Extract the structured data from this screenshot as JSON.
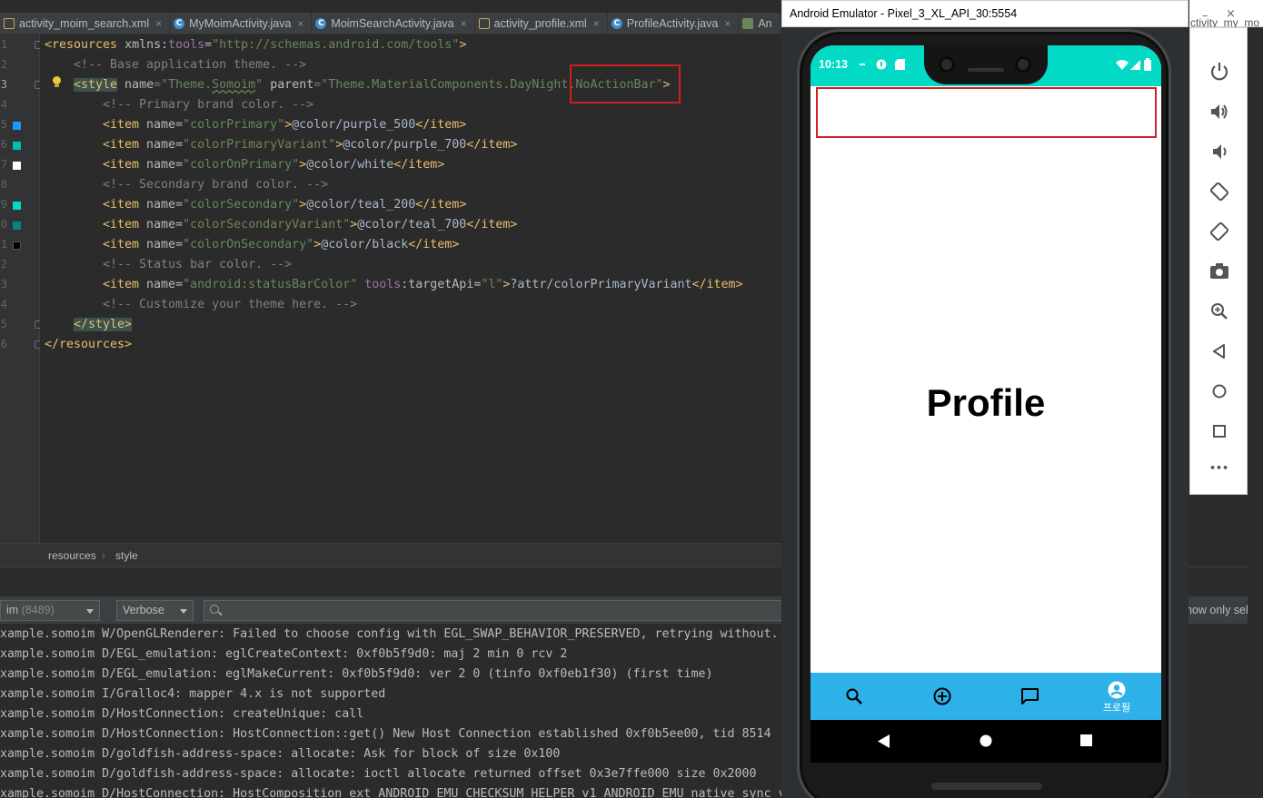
{
  "ide": {
    "tabs": [
      {
        "label": "activity_moim_search.xml",
        "type": "xml"
      },
      {
        "label": "MyMoimActivity.java",
        "type": "java"
      },
      {
        "label": "MoimSearchActivity.java",
        "type": "java"
      },
      {
        "label": "activity_profile.xml",
        "type": "xml"
      },
      {
        "label": "ProfileActivity.java",
        "type": "java"
      },
      {
        "label": "An",
        "type": "mf"
      }
    ],
    "line_numbers": [
      "1",
      "2",
      "3",
      "4",
      "5",
      "6",
      "7",
      "8",
      "9",
      "0",
      "1",
      "2",
      "3",
      "4",
      "5",
      "6"
    ],
    "swatch_colors": {
      "purple_500": "#2196f3",
      "purple_700": "#00bfae",
      "white": "#ffffff",
      "teal_200": "#03dac5",
      "teal_700": "#018786",
      "black": "#000000"
    },
    "code": {
      "l1_open": "<resources ",
      "l1_attr": "xmlns:",
      "l1_ns": "tools",
      "l1_eq": "=",
      "l1_val": "\"http://schemas.android.com/tools\"",
      "l1_close": ">",
      "l2": "<!-- Base application theme. -->",
      "l3_open": "<style",
      "l3_name_attr": " name",
      "l3_name_val_pre": "=\"Theme.",
      "l3_name_val_mid": "Somoim",
      "l3_name_val_post": "\"",
      "l3_parent_attr": " parent",
      "l3_parent_val": "=\"Theme.MaterialComponents.DayNight.NoActionBar\"",
      "l3_close": ">",
      "l4": "<!-- Primary brand color. -->",
      "l5_name": "\"colorPrimary\"",
      "l5_val": "@color/purple_500",
      "l6_name": "\"colorPrimaryVariant\"",
      "l6_val": "@color/purple_700",
      "l7_name": "\"colorOnPrimary\"",
      "l7_val": "@color/white",
      "l8": "<!-- Secondary brand color. -->",
      "l9_name": "\"colorSecondary\"",
      "l9_val": "@color/teal_200",
      "l10_name": "\"colorSecondaryVariant\"",
      "l10_val": "@color/teal_700",
      "l11_name": "\"colorOnSecondary\"",
      "l11_val": "@color/black",
      "l12": "<!-- Status bar color. -->",
      "l13_name": "\"android:statusBarColor\"",
      "l13_tools": " tools",
      "l13_target": ":targetApi",
      "l13_target_val": "\"l\"",
      "l13_val": "?attr/colorPrimaryVariant",
      "l14": "<!-- Customize your theme here. -->",
      "l15": "</style>",
      "l16": "</resources>",
      "item_open": "<item",
      "item_name_attr": " name",
      "eq": "=",
      "gt": ">",
      "item_close": "</item>"
    },
    "breadcrumb": [
      "resources",
      "style"
    ],
    "breadcrumb_sep": "›",
    "logcat": {
      "process": "im",
      "pid": "(8489)",
      "level": "Verbose",
      "search_placeholder": "",
      "show_only": "how only selecte",
      "lines": [
        "xample.somoim W/OpenGLRenderer: Failed to choose config with EGL_SWAP_BEHAVIOR_PRESERVED, retrying without...",
        "xample.somoim D/EGL_emulation: eglCreateContext: 0xf0b5f9d0: maj 2 min 0 rcv 2",
        "xample.somoim D/EGL_emulation: eglMakeCurrent: 0xf0b5f9d0: ver 2 0 (tinfo 0xf0eb1f30) (first time)",
        "xample.somoim I/Gralloc4: mapper 4.x is not supported",
        "xample.somoim D/HostConnection: createUnique: call",
        "xample.somoim D/HostConnection: HostConnection::get() New Host Connection established 0xf0b5ee00, tid 8514",
        "xample.somoim D/goldfish-address-space: allocate: Ask for block of size 0x100",
        "xample.somoim D/goldfish-address-space: allocate: ioctl allocate returned offset 0x3e7ffe000 size 0x2000",
        "xample.somoim D/HostConnection: HostComposition ext ANDROID_EMU_CHECKSUM_HELPER_v1 ANDROID_EMU_native_sync_v"
      ]
    }
  },
  "emulator": {
    "window_title": "Android Emulator - Pixel_3_XL_API_30:5554",
    "status_time": "10:13",
    "screen_title": "Profile",
    "bottom_nav": {
      "profile_label": "프로필"
    },
    "side_peek": "ctivity_my_mo",
    "minimize": "–",
    "close": "×",
    "more": "•••",
    "status_color": "#03dac5",
    "nav_color": "#2eb0e8"
  }
}
